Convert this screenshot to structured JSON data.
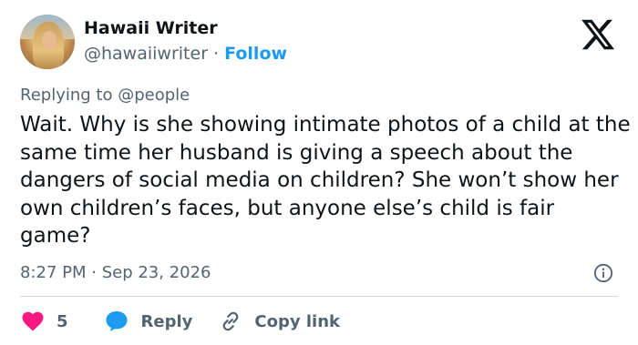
{
  "author": {
    "name": "Hawaii Writer",
    "handle": "@hawaiiwriter",
    "separator": "·",
    "follow_label": "Follow"
  },
  "reply_context": "Replying to @people",
  "tweet": {
    "text": "Wait. Why is she showing intimate photos of a child at the same time her husband is giving a speech about the dangers of social media on children? She won’t show her own children’s faces, but anyone else’s child is fair game?",
    "timestamp": "8:27 PM · Sep 23, 2026"
  },
  "actions": {
    "like_count": "5",
    "reply_label": "Reply",
    "copy_link_label": "Copy link"
  },
  "icons": {
    "logo": "x-logo-icon",
    "info": "info-icon",
    "like": "heart-icon",
    "reply": "speech-bubble-icon",
    "copy_link": "link-icon"
  },
  "colors": {
    "accent": "#1d9bf0",
    "like": "#f91880",
    "secondary_text": "#536471",
    "primary_text": "#0f1419"
  }
}
